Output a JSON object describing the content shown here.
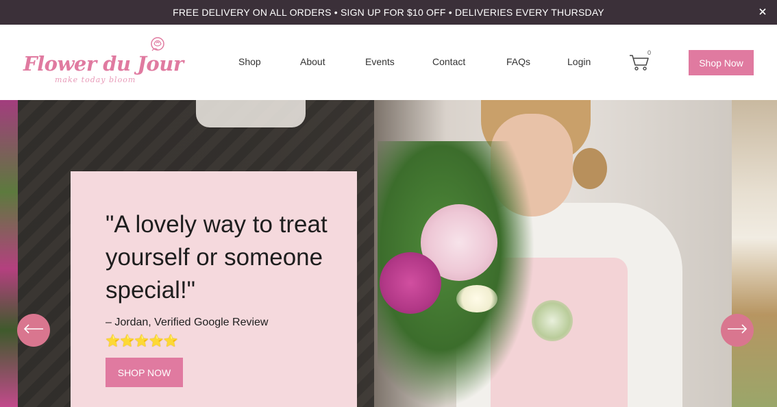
{
  "announcement": {
    "text": "FREE DELIVERY ON ALL ORDERS • SIGN UP FOR $10 OFF • DELIVERIES EVERY THURSDAY",
    "close_icon": "close-icon"
  },
  "brand": {
    "name": "Flower du Jour",
    "tagline": "make today bloom",
    "accent_color": "#e07aa0",
    "dark_color": "#3b3039",
    "card_color": "#f5d9dd"
  },
  "nav": {
    "items": [
      {
        "label": "Shop"
      },
      {
        "label": "About"
      },
      {
        "label": "Events"
      },
      {
        "label": "Contact"
      },
      {
        "label": "FAQs"
      },
      {
        "label": "Login"
      }
    ],
    "cart_count": "0",
    "cart_icon": "cart-icon",
    "cta_label": "Shop Now"
  },
  "hero": {
    "quote": "\"A lovely way to treat yourself or someone special!\"",
    "author": "– Jordan,  Verified Google Review",
    "rating": 5,
    "stars": "⭐⭐⭐⭐⭐",
    "button_label": "SHOP NOW",
    "prev_icon": "arrow-left-icon",
    "next_icon": "arrow-right-icon"
  }
}
